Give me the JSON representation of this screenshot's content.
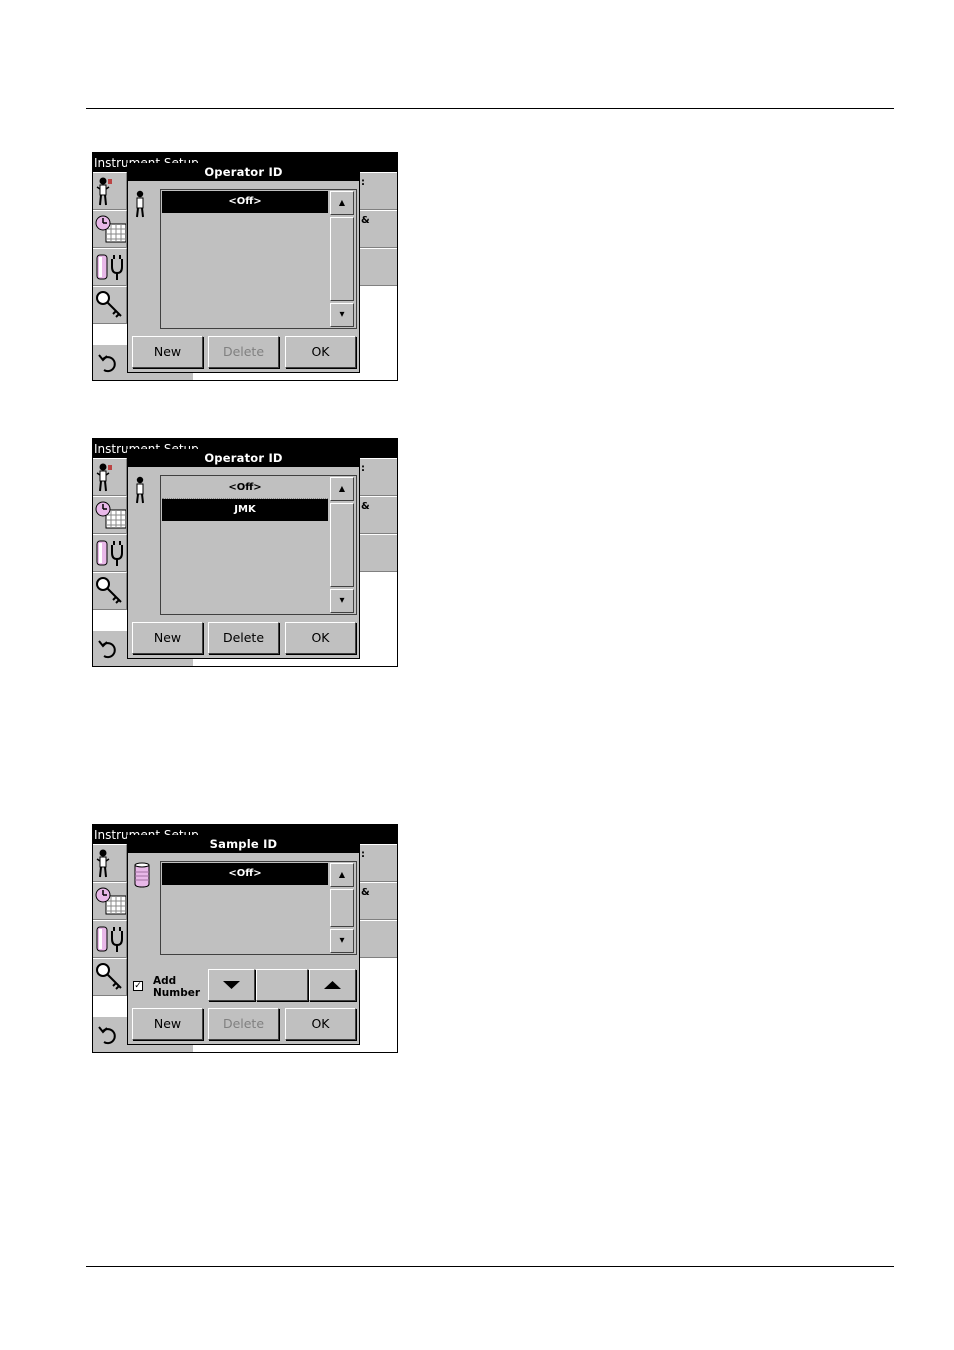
{
  "page": {},
  "screen1": {
    "bg_title": "Instrument Setup",
    "right_buttons": [
      ":",
      "&",
      ""
    ],
    "dialog": {
      "title": "Operator ID",
      "icon": "operator-icon",
      "list_items": [
        "<Off>"
      ],
      "selected_index": 0,
      "buttons": {
        "new": "New",
        "delete": "Delete",
        "ok": "OK"
      },
      "delete_enabled": false
    }
  },
  "screen2": {
    "bg_title": "Instrument Setup",
    "right_buttons": [
      ":",
      "&",
      ""
    ],
    "dialog": {
      "title": "Operator ID",
      "icon": "operator-icon",
      "list_items": [
        "<Off>",
        "JMK"
      ],
      "selected_index": 1,
      "buttons": {
        "new": "New",
        "delete": "Delete",
        "ok": "OK"
      },
      "delete_enabled": true
    }
  },
  "screen3": {
    "bg_title": "Instrument Setup",
    "right_buttons": [
      ":",
      "&",
      ""
    ],
    "dialog": {
      "title": "Sample ID",
      "icon": "sample-beaker-icon",
      "list_items": [
        "<Off>"
      ],
      "selected_index": 0,
      "add_number": {
        "label_line1": "Add",
        "label_line2": "Number",
        "checked": true,
        "check_mark": "✓"
      },
      "buttons": {
        "new": "New",
        "delete": "Delete",
        "ok": "OK"
      },
      "delete_enabled": false
    }
  },
  "icons": {
    "sidebar": [
      "operator-id-icon",
      "clock-calendar-icon",
      "battery-power-icon",
      "key-security-icon"
    ],
    "back": "undo-arrow-icon",
    "scroll_up": "▲",
    "scroll_down": "▾"
  },
  "colors": {
    "panel": "#c0c0c0",
    "title_bar": "#000000",
    "selection": "#000000",
    "disabled_text": "#808080"
  }
}
